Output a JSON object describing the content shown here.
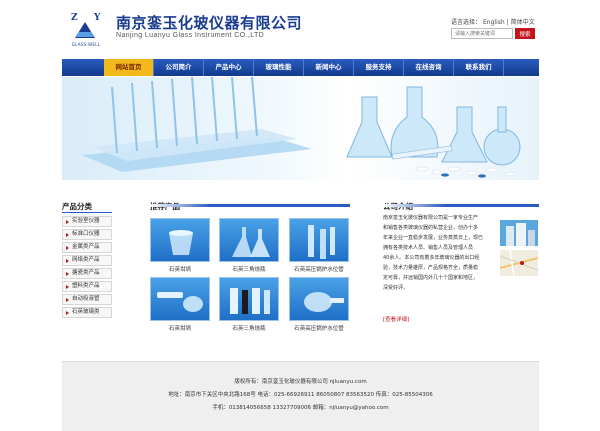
{
  "header": {
    "logo_letters": "ZLY",
    "logo_subtext": "GLASS WELL",
    "company_cn": "南京銮玉化玻仪器有限公司",
    "company_en": "Nanjing Luanyu Glass Instrument CO.,LTD",
    "lang_label": "语言选择：",
    "lang_english": "English",
    "lang_sep": "|",
    "lang_chinese": "简体中文",
    "search_placeholder": "请输入搜索关键词",
    "search_button": "搜索"
  },
  "nav": {
    "items": [
      "网站首页",
      "公司简介",
      "产品中心",
      "玻璃性能",
      "新闻中心",
      "服务支持",
      "在线咨询",
      "联系我们"
    ]
  },
  "categories": {
    "title": "产品分类",
    "items": [
      "实验室仪器",
      "标准口仪器",
      "金属类产品",
      "网络类产品",
      "搪瓷类产品",
      "塑料类产品",
      "自动吸液管",
      "石英玻璃类"
    ]
  },
  "products": {
    "title": "推荐产品",
    "items": [
      {
        "caption": "石英坩埚"
      },
      {
        "caption": "石英三角烧瓶"
      },
      {
        "caption": "石英高压锅炉水位管"
      },
      {
        "caption": "石英坩埚"
      },
      {
        "caption": "石英三角烧瓶"
      },
      {
        "caption": "石英高压锅炉水位管"
      }
    ]
  },
  "intro": {
    "title": "公司介绍",
    "lines": [
      "南京銮玉化玻仪器有限公司是一家专业生产",
      "和销售各类玻璃仪器的私营企业，创办十多",
      "年来企业一直稳步发展，业务蒸蒸日上，现已",
      "拥有各类技术人员、销售人员及管理人员",
      "40余人。本公司有着多年玻璃仪器的出口经",
      "验，技术力量雄厚，产品规格齐全，质量稳",
      "定可靠，并远销国内外几十个国家和地区，",
      "深受好评。"
    ],
    "more": "[查看详细]"
  },
  "footer": {
    "line1": "版权所有：南京銮玉化玻仪器有限公司 njluanyu.com",
    "line2": "地址：南京市下关区中央北路168号  电话：025-66926911 86050807 83563520  传真：025-85504306",
    "line3": "手机：013814056658 13327709006  邮箱：njluanyu@yahoo.com"
  },
  "colors": {
    "brand_blue": "#1a3d8f",
    "nav_blue": "#2a5cbf",
    "nav_active": "#f3b91a",
    "accent_red": "#c2161c"
  }
}
